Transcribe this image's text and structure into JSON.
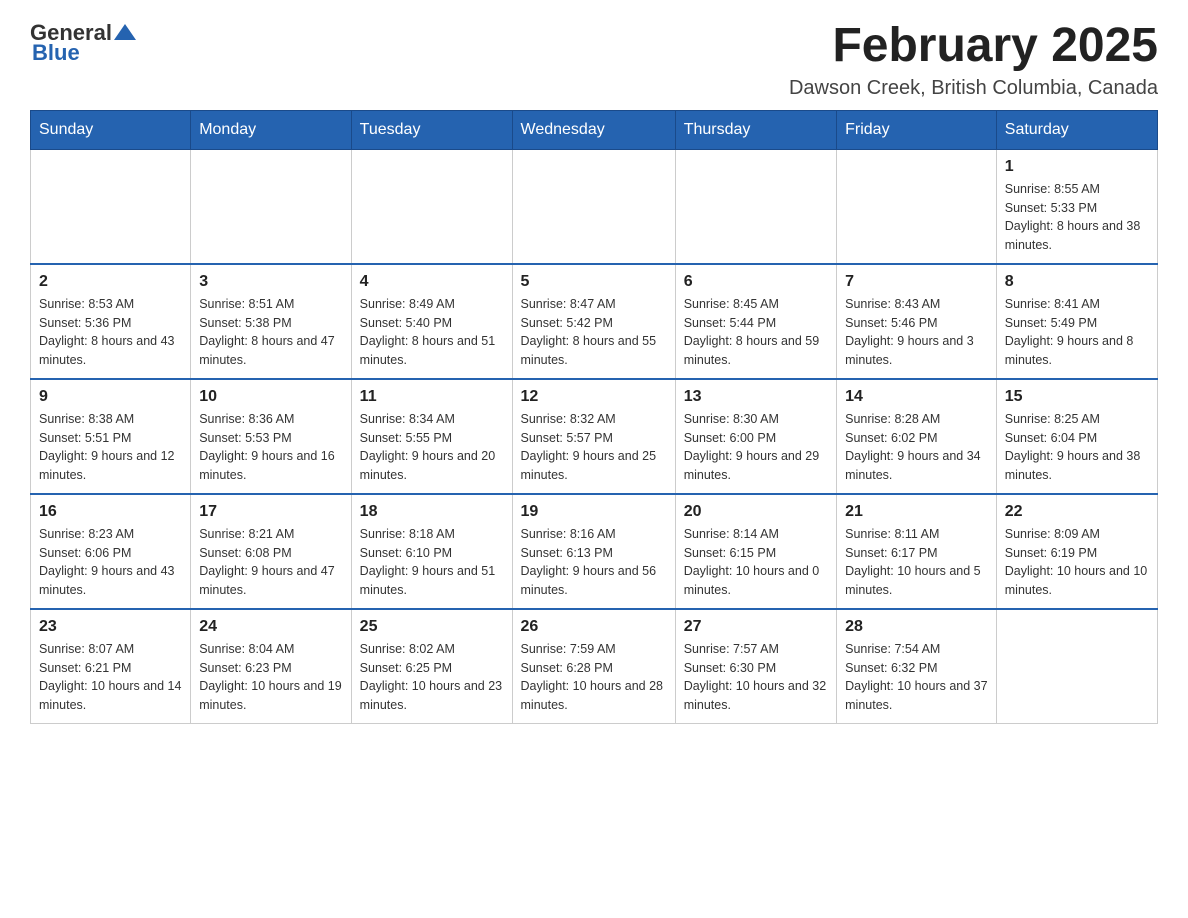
{
  "header": {
    "logo": {
      "general": "General",
      "blue": "Blue"
    },
    "title": "February 2025",
    "location": "Dawson Creek, British Columbia, Canada"
  },
  "weekdays": [
    "Sunday",
    "Monday",
    "Tuesday",
    "Wednesday",
    "Thursday",
    "Friday",
    "Saturday"
  ],
  "weeks": [
    [
      {
        "day": "",
        "info": ""
      },
      {
        "day": "",
        "info": ""
      },
      {
        "day": "",
        "info": ""
      },
      {
        "day": "",
        "info": ""
      },
      {
        "day": "",
        "info": ""
      },
      {
        "day": "",
        "info": ""
      },
      {
        "day": "1",
        "info": "Sunrise: 8:55 AM\nSunset: 5:33 PM\nDaylight: 8 hours and 38 minutes."
      }
    ],
    [
      {
        "day": "2",
        "info": "Sunrise: 8:53 AM\nSunset: 5:36 PM\nDaylight: 8 hours and 43 minutes."
      },
      {
        "day": "3",
        "info": "Sunrise: 8:51 AM\nSunset: 5:38 PM\nDaylight: 8 hours and 47 minutes."
      },
      {
        "day": "4",
        "info": "Sunrise: 8:49 AM\nSunset: 5:40 PM\nDaylight: 8 hours and 51 minutes."
      },
      {
        "day": "5",
        "info": "Sunrise: 8:47 AM\nSunset: 5:42 PM\nDaylight: 8 hours and 55 minutes."
      },
      {
        "day": "6",
        "info": "Sunrise: 8:45 AM\nSunset: 5:44 PM\nDaylight: 8 hours and 59 minutes."
      },
      {
        "day": "7",
        "info": "Sunrise: 8:43 AM\nSunset: 5:46 PM\nDaylight: 9 hours and 3 minutes."
      },
      {
        "day": "8",
        "info": "Sunrise: 8:41 AM\nSunset: 5:49 PM\nDaylight: 9 hours and 8 minutes."
      }
    ],
    [
      {
        "day": "9",
        "info": "Sunrise: 8:38 AM\nSunset: 5:51 PM\nDaylight: 9 hours and 12 minutes."
      },
      {
        "day": "10",
        "info": "Sunrise: 8:36 AM\nSunset: 5:53 PM\nDaylight: 9 hours and 16 minutes."
      },
      {
        "day": "11",
        "info": "Sunrise: 8:34 AM\nSunset: 5:55 PM\nDaylight: 9 hours and 20 minutes."
      },
      {
        "day": "12",
        "info": "Sunrise: 8:32 AM\nSunset: 5:57 PM\nDaylight: 9 hours and 25 minutes."
      },
      {
        "day": "13",
        "info": "Sunrise: 8:30 AM\nSunset: 6:00 PM\nDaylight: 9 hours and 29 minutes."
      },
      {
        "day": "14",
        "info": "Sunrise: 8:28 AM\nSunset: 6:02 PM\nDaylight: 9 hours and 34 minutes."
      },
      {
        "day": "15",
        "info": "Sunrise: 8:25 AM\nSunset: 6:04 PM\nDaylight: 9 hours and 38 minutes."
      }
    ],
    [
      {
        "day": "16",
        "info": "Sunrise: 8:23 AM\nSunset: 6:06 PM\nDaylight: 9 hours and 43 minutes."
      },
      {
        "day": "17",
        "info": "Sunrise: 8:21 AM\nSunset: 6:08 PM\nDaylight: 9 hours and 47 minutes."
      },
      {
        "day": "18",
        "info": "Sunrise: 8:18 AM\nSunset: 6:10 PM\nDaylight: 9 hours and 51 minutes."
      },
      {
        "day": "19",
        "info": "Sunrise: 8:16 AM\nSunset: 6:13 PM\nDaylight: 9 hours and 56 minutes."
      },
      {
        "day": "20",
        "info": "Sunrise: 8:14 AM\nSunset: 6:15 PM\nDaylight: 10 hours and 0 minutes."
      },
      {
        "day": "21",
        "info": "Sunrise: 8:11 AM\nSunset: 6:17 PM\nDaylight: 10 hours and 5 minutes."
      },
      {
        "day": "22",
        "info": "Sunrise: 8:09 AM\nSunset: 6:19 PM\nDaylight: 10 hours and 10 minutes."
      }
    ],
    [
      {
        "day": "23",
        "info": "Sunrise: 8:07 AM\nSunset: 6:21 PM\nDaylight: 10 hours and 14 minutes."
      },
      {
        "day": "24",
        "info": "Sunrise: 8:04 AM\nSunset: 6:23 PM\nDaylight: 10 hours and 19 minutes."
      },
      {
        "day": "25",
        "info": "Sunrise: 8:02 AM\nSunset: 6:25 PM\nDaylight: 10 hours and 23 minutes."
      },
      {
        "day": "26",
        "info": "Sunrise: 7:59 AM\nSunset: 6:28 PM\nDaylight: 10 hours and 28 minutes."
      },
      {
        "day": "27",
        "info": "Sunrise: 7:57 AM\nSunset: 6:30 PM\nDaylight: 10 hours and 32 minutes."
      },
      {
        "day": "28",
        "info": "Sunrise: 7:54 AM\nSunset: 6:32 PM\nDaylight: 10 hours and 37 minutes."
      },
      {
        "day": "",
        "info": ""
      }
    ]
  ]
}
